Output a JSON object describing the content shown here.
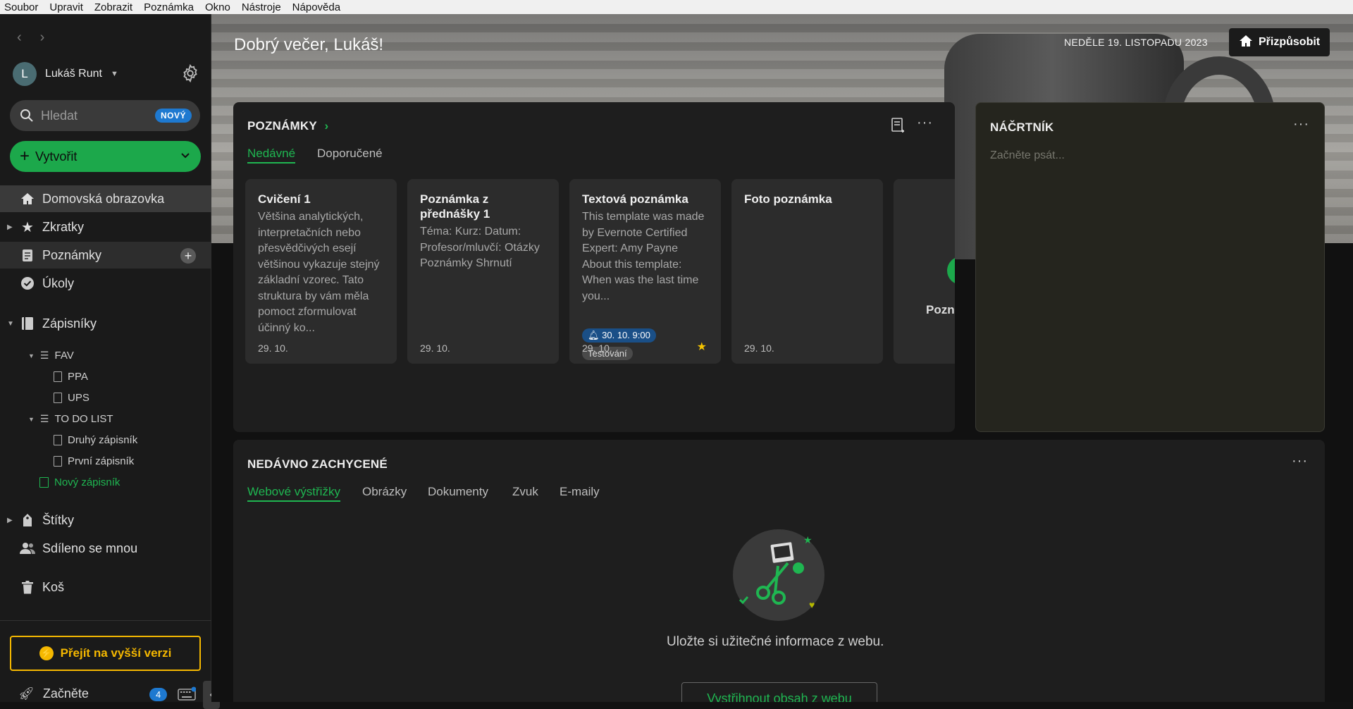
{
  "menubar": [
    "Soubor",
    "Upravit",
    "Zobrazit",
    "Poznámka",
    "Okno",
    "Nástroje",
    "Nápověda"
  ],
  "sidebar": {
    "avatar_letter": "L",
    "user_name": "Lukáš Runt",
    "search_placeholder": "Hledat",
    "search_badge": "NOVÝ",
    "create_label": "Vytvořit",
    "nav": {
      "home": "Domovská obrazovka",
      "shortcuts": "Zkratky",
      "notes": "Poznámky",
      "tasks": "Úkoly",
      "notebooks": "Zápisníky",
      "tags": "Štítky",
      "shared": "Sdíleno se mnou",
      "trash": "Koš"
    },
    "tree": {
      "fav": "FAV",
      "ppa": "PPA",
      "ups": "UPS",
      "todo": "TO DO LIST",
      "second": "Druhý zápisník",
      "first": "První zápisník",
      "new_notebook": "Nový zápisník"
    },
    "upgrade_label": "Přejít na vyšší verzi",
    "start_label": "Začněte",
    "start_count": "4"
  },
  "hero": {
    "greeting": "Dobrý večer, Lukáš!",
    "date": "NEDĚLE 19. LISTOPADU 2023",
    "customize_label": "Přizpůsobit"
  },
  "notes_panel": {
    "title": "POZNÁMKY",
    "tabs": [
      "Nedávné",
      "Doporučené"
    ],
    "cards": [
      {
        "title": "Cvičení 1",
        "body": "Většina analytických, interpretačních nebo přesvědčivých esejí většinou vykazuje stejný základní vzorec. Tato struktura by vám měla pomoct zformulovat účinný ko...",
        "date": "29. 10."
      },
      {
        "title": "Poznámka z přednášky 1",
        "body": "Téma: Kurz: Datum: Profesor/mluvčí: Otázky Poznámky Shrnutí",
        "date": "29. 10."
      },
      {
        "title": "Textová poznámka",
        "body": "This template was made by Evernote Certified Expert: Amy Payne About this template: When was the last time you...",
        "date": "29. 10.",
        "reminder": "30. 10. 9:00",
        "tag": "Testování"
      },
      {
        "title": "Foto poznámka",
        "body": "",
        "date": "29. 10."
      }
    ],
    "partial_card_text": "Pozn"
  },
  "sketch": {
    "title": "NÁČRTNÍK",
    "placeholder": "Začněte psát..."
  },
  "captured": {
    "title": "NEDÁVNO ZACHYCENÉ",
    "tabs": [
      "Webové výstřižky",
      "Obrázky",
      "Dokumenty",
      "Zvuk",
      "E-maily"
    ],
    "empty_text": "Uložte si užitečné informace z webu.",
    "button_label": "Vystřihnout obsah z webu"
  },
  "colors": {
    "accent": "#1fb651",
    "upgrade": "#f5b800",
    "badge": "#1e79d0"
  }
}
